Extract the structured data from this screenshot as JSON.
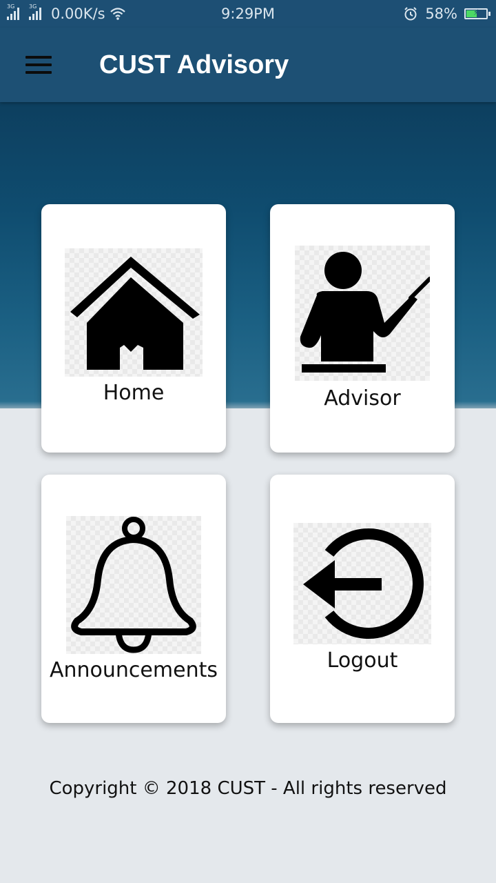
{
  "status_bar": {
    "network_1": "3G",
    "network_2": "3G",
    "speed": "0.00K/s",
    "time": "9:29PM",
    "battery_percent": "58%",
    "battery_level": 0.58,
    "battery_color": "#4cd964"
  },
  "app_bar": {
    "title": "CUST Advisory",
    "menu_icon": "hamburger-menu-icon",
    "color": "#1d5074"
  },
  "cards": {
    "home": {
      "label": "Home",
      "icon": "house-icon"
    },
    "advisor": {
      "label": "Advisor",
      "icon": "teacher-pointer-icon"
    },
    "announcements": {
      "label": "Announcements",
      "icon": "bell-icon"
    },
    "logout": {
      "label": "Logout",
      "icon": "logout-arrow-icon"
    }
  },
  "footer": {
    "copyright": "Copyright © 2018 CUST - All rights reserved"
  }
}
